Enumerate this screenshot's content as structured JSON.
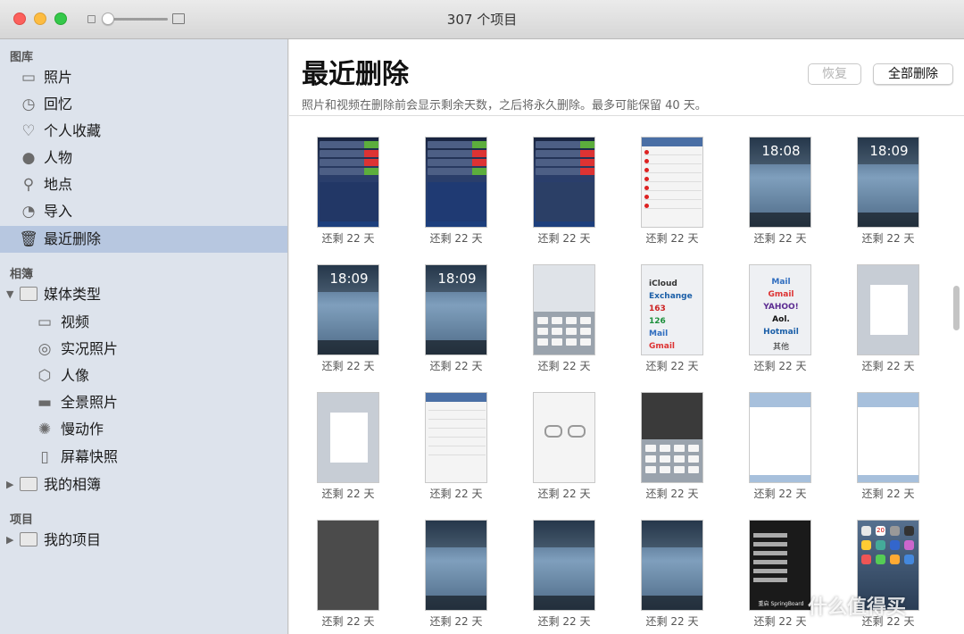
{
  "window": {
    "title": "307 个项目"
  },
  "sidebar": {
    "sections": [
      {
        "title": "图库"
      },
      {
        "title": "相簿"
      },
      {
        "title": "项目"
      }
    ],
    "library_items": [
      {
        "label": "照片",
        "icon": "photos-icon"
      },
      {
        "label": "回忆",
        "icon": "memories-icon"
      },
      {
        "label": "个人收藏",
        "icon": "heart-icon"
      },
      {
        "label": "人物",
        "icon": "person-icon"
      },
      {
        "label": "地点",
        "icon": "pin-icon"
      },
      {
        "label": "导入",
        "icon": "clock-icon"
      },
      {
        "label": "最近删除",
        "icon": "trash-icon"
      }
    ],
    "album_items": [
      {
        "label": "媒体类型"
      },
      {
        "label": "视频"
      },
      {
        "label": "实况照片"
      },
      {
        "label": "人像"
      },
      {
        "label": "全景照片"
      },
      {
        "label": "慢动作"
      },
      {
        "label": "屏幕快照"
      },
      {
        "label": "我的相簿"
      }
    ],
    "project_items": [
      {
        "label": "我的项目"
      }
    ],
    "selected": "最近删除"
  },
  "main": {
    "title": "最近删除",
    "subtitle": "照片和视频在删除前会显示剩余天数，之后将永久删除。最多可能保留 40 天。",
    "restore_label": "恢复",
    "delete_all_label": "全部删除",
    "caption": "还剩 22 天"
  },
  "thumb_text": {
    "lock_time": "18:09",
    "lock_time_alt": "18:08",
    "mail": [
      "iCloud",
      "Exchange",
      "163",
      "126",
      "Mail",
      "Gmail"
    ],
    "mail2": [
      "Mail",
      "Gmail",
      "YAHOO!",
      "Aol.",
      "Hotmail",
      "其他"
    ],
    "springboard": "重启 SpringBoard",
    "home_badge": "20"
  },
  "watermark": "什么值得买",
  "colors": {
    "sidebar_bg": "#dde3ec",
    "selected_bg": "#b7c7e0",
    "accent": "#4a6fa5"
  }
}
